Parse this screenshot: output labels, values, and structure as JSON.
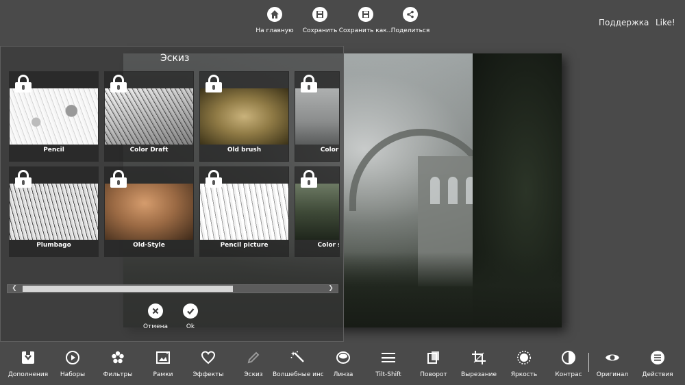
{
  "header": {
    "actions": [
      {
        "label": "На главную",
        "icon": "home-icon"
      },
      {
        "label": "Сохранить",
        "icon": "save-icon"
      },
      {
        "label": "Сохранить как...",
        "icon": "save-as-icon"
      },
      {
        "label": "Поделиться",
        "icon": "share-icon"
      }
    ],
    "support_label": "Поддержка",
    "like_label": "Like!"
  },
  "panel": {
    "title": "Эскиз",
    "effects": [
      {
        "name": "Pencil",
        "locked": true
      },
      {
        "name": "Color Draft",
        "locked": true
      },
      {
        "name": "Old brush",
        "locked": true
      },
      {
        "name": "Color",
        "locked": true
      },
      {
        "name": "Plumbago",
        "locked": true
      },
      {
        "name": "Old-Style",
        "locked": true
      },
      {
        "name": "Pencil picture",
        "locked": true
      },
      {
        "name": "Color s",
        "locked": true
      }
    ],
    "cancel_label": "Отмена",
    "ok_label": "Ok",
    "scroll_position": 0.0
  },
  "toolbar": {
    "tools": [
      {
        "label": "Дополнения",
        "icon": "addons-icon"
      },
      {
        "label": "Наборы",
        "icon": "play-icon"
      },
      {
        "label": "Фильтры",
        "icon": "flower-icon"
      },
      {
        "label": "Рамки",
        "icon": "frame-icon"
      },
      {
        "label": "Эффекты",
        "icon": "heart-icon"
      },
      {
        "label": "Эскиз",
        "icon": "pencil-icon"
      },
      {
        "label": "Волшебные инс",
        "icon": "magic-wand-icon"
      },
      {
        "label": "Линза",
        "icon": "lens-icon"
      },
      {
        "label": "Tilt-Shift",
        "icon": "tilt-shift-icon"
      },
      {
        "label": "Поворот",
        "icon": "rotate-icon"
      },
      {
        "label": "Вырезание",
        "icon": "crop-icon"
      },
      {
        "label": "Яркость",
        "icon": "brightness-icon"
      },
      {
        "label": "Контрас",
        "icon": "contrast-icon"
      },
      {
        "label": "Оригинал",
        "icon": "eye-icon"
      },
      {
        "label": "Действия",
        "icon": "menu-list-icon"
      }
    ]
  },
  "colors": {
    "background": "#4a4a4a",
    "panel": "#3a3a3a",
    "icon": "#ffffff"
  }
}
